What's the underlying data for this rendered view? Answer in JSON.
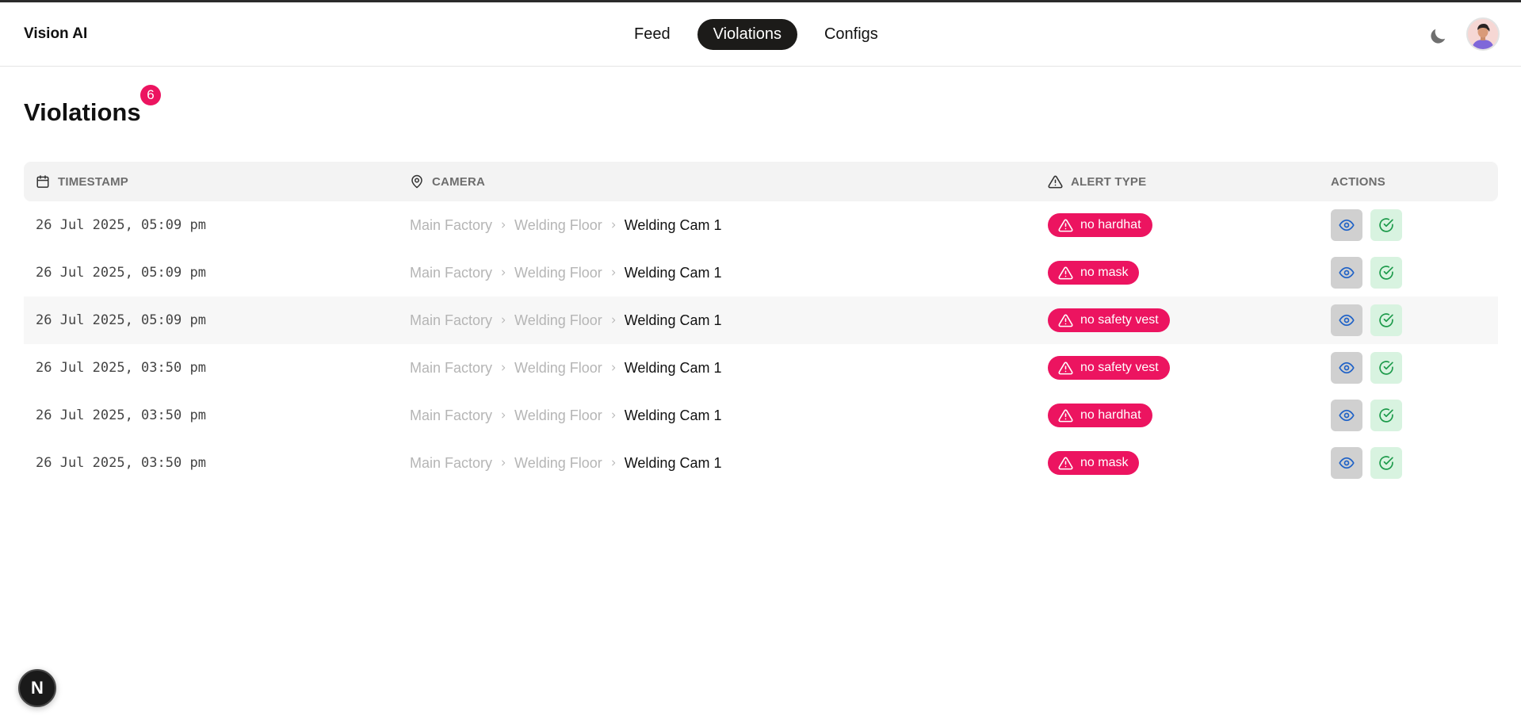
{
  "app": {
    "brand": "Vision AI"
  },
  "nav": {
    "tabs": [
      {
        "label": "Feed",
        "active": false
      },
      {
        "label": "Violations",
        "active": true
      },
      {
        "label": "Configs",
        "active": false
      }
    ]
  },
  "header_icons": {
    "theme_toggle": "moon-icon",
    "avatar": "user-avatar"
  },
  "page": {
    "title": "Violations",
    "count": "6"
  },
  "table": {
    "columns": [
      {
        "label": "TIMESTAMP",
        "icon": "calendar-icon"
      },
      {
        "label": "CAMERA",
        "icon": "map-pin-icon"
      },
      {
        "label": "ALERT TYPE",
        "icon": "warning-triangle-icon"
      },
      {
        "label": "ACTIONS",
        "icon": ""
      }
    ],
    "rows": [
      {
        "timestamp": "26 Jul 2025, 05:09 pm",
        "location": "Main Factory",
        "area": "Welding Floor",
        "camera": "Welding Cam 1",
        "alert": "no hardhat"
      },
      {
        "timestamp": "26 Jul 2025, 05:09 pm",
        "location": "Main Factory",
        "area": "Welding Floor",
        "camera": "Welding Cam 1",
        "alert": "no mask"
      },
      {
        "timestamp": "26 Jul 2025, 05:09 pm",
        "location": "Main Factory",
        "area": "Welding Floor",
        "camera": "Welding Cam 1",
        "alert": "no safety vest"
      },
      {
        "timestamp": "26 Jul 2025, 03:50 pm",
        "location": "Main Factory",
        "area": "Welding Floor",
        "camera": "Welding Cam 1",
        "alert": "no safety vest"
      },
      {
        "timestamp": "26 Jul 2025, 03:50 pm",
        "location": "Main Factory",
        "area": "Welding Floor",
        "camera": "Welding Cam 1",
        "alert": "no hardhat"
      },
      {
        "timestamp": "26 Jul 2025, 03:50 pm",
        "location": "Main Factory",
        "area": "Welding Floor",
        "camera": "Welding Cam 1",
        "alert": "no mask"
      }
    ]
  },
  "dev_badge": {
    "label": "N"
  },
  "colors": {
    "accent": "#ec1460",
    "active_tab": "#1c1b19",
    "view_button": "#d0d0d0",
    "resolve_button": "#d8f3e0",
    "view_icon": "#1f62c7",
    "resolve_icon": "#1c9a4a"
  }
}
